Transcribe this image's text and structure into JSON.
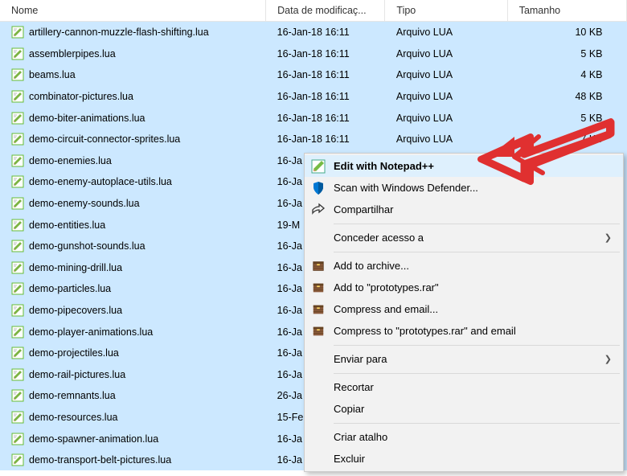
{
  "columns": {
    "nome": "Nome",
    "date": "Data de modificaç...",
    "tipo": "Tipo",
    "size": "Tamanho"
  },
  "files": [
    {
      "name": "artillery-cannon-muzzle-flash-shifting.lua",
      "date": "16-Jan-18 16:11",
      "tipo": "Arquivo LUA",
      "size": "10 KB"
    },
    {
      "name": "assemblerpipes.lua",
      "date": "16-Jan-18 16:11",
      "tipo": "Arquivo LUA",
      "size": "5 KB"
    },
    {
      "name": "beams.lua",
      "date": "16-Jan-18 16:11",
      "tipo": "Arquivo LUA",
      "size": "4 KB"
    },
    {
      "name": "combinator-pictures.lua",
      "date": "16-Jan-18 16:11",
      "tipo": "Arquivo LUA",
      "size": "48 KB"
    },
    {
      "name": "demo-biter-animations.lua",
      "date": "16-Jan-18 16:11",
      "tipo": "Arquivo LUA",
      "size": "5 KB"
    },
    {
      "name": "demo-circuit-connector-sprites.lua",
      "date": "16-Jan-18 16:11",
      "tipo": "Arquivo LUA",
      "size": "7 KB"
    },
    {
      "name": "demo-enemies.lua",
      "date": "16-Ja",
      "tipo": "",
      "size": ""
    },
    {
      "name": "demo-enemy-autoplace-utils.lua",
      "date": "16-Ja",
      "tipo": "",
      "size": ""
    },
    {
      "name": "demo-enemy-sounds.lua",
      "date": "16-Ja",
      "tipo": "",
      "size": ""
    },
    {
      "name": "demo-entities.lua",
      "date": "19-M",
      "tipo": "",
      "size": ""
    },
    {
      "name": "demo-gunshot-sounds.lua",
      "date": "16-Ja",
      "tipo": "",
      "size": ""
    },
    {
      "name": "demo-mining-drill.lua",
      "date": "16-Ja",
      "tipo": "",
      "size": ""
    },
    {
      "name": "demo-particles.lua",
      "date": "16-Ja",
      "tipo": "",
      "size": ""
    },
    {
      "name": "demo-pipecovers.lua",
      "date": "16-Ja",
      "tipo": "",
      "size": ""
    },
    {
      "name": "demo-player-animations.lua",
      "date": "16-Ja",
      "tipo": "",
      "size": ""
    },
    {
      "name": "demo-projectiles.lua",
      "date": "16-Ja",
      "tipo": "",
      "size": ""
    },
    {
      "name": "demo-rail-pictures.lua",
      "date": "16-Ja",
      "tipo": "",
      "size": ""
    },
    {
      "name": "demo-remnants.lua",
      "date": "26-Ja",
      "tipo": "",
      "size": ""
    },
    {
      "name": "demo-resources.lua",
      "date": "15-Fe",
      "tipo": "",
      "size": ""
    },
    {
      "name": "demo-spawner-animation.lua",
      "date": "16-Ja",
      "tipo": "",
      "size": ""
    },
    {
      "name": "demo-transport-belt-pictures.lua",
      "date": "16-Ja",
      "tipo": "",
      "size": ""
    }
  ],
  "context_menu": {
    "edit_notepad": "Edit with Notepad++",
    "scan_defender": "Scan with Windows Defender...",
    "compartilhar": "Compartilhar",
    "conceder": "Conceder acesso a",
    "add_archive": "Add to archive...",
    "add_to_rar": "Add to \"prototypes.rar\"",
    "compress_email": "Compress and email...",
    "compress_to_email": "Compress to \"prototypes.rar\" and email",
    "enviar": "Enviar para",
    "recortar": "Recortar",
    "copiar": "Copiar",
    "criar_atalho": "Criar atalho",
    "excluir": "Excluir"
  }
}
